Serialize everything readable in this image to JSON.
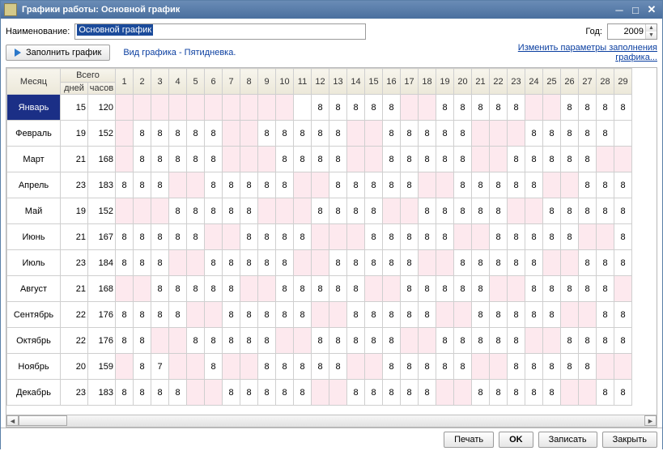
{
  "window": {
    "title": "Графики работы: Основной график"
  },
  "labels": {
    "name": "Наименование:",
    "year": "Год:",
    "fill_button": "Заполнить график",
    "schedule_info": "Вид графика - Пятидневка.",
    "change_link_line1": "Изменить параметры заполнения",
    "change_link_line2": "графика...",
    "header_month": "Месяц",
    "header_total": "Всего",
    "header_days": "дней",
    "header_hours": "часов"
  },
  "name_value": "Основной график",
  "year_value": "2009",
  "footer": {
    "print": "Печать",
    "ok": "OK",
    "save": "Записать",
    "close": "Закрыть"
  },
  "day_numbers": [
    1,
    2,
    3,
    4,
    5,
    6,
    7,
    8,
    9,
    10,
    11,
    12,
    13,
    14,
    15,
    16,
    17,
    18,
    19,
    20,
    21,
    22,
    23,
    24,
    25,
    26,
    27,
    28,
    29
  ],
  "months": [
    {
      "name": "Январь",
      "days": 15,
      "hours": 120,
      "selected": true,
      "cells": [
        "o",
        "o",
        "o",
        "o",
        "o",
        "o",
        "o",
        "o",
        "o",
        "o",
        "",
        "8",
        "8",
        "8",
        "8",
        "8",
        "o",
        "o",
        "8",
        "8",
        "8",
        "8",
        "8",
        "o",
        "o",
        "8",
        "8",
        "8",
        "8"
      ]
    },
    {
      "name": "Февраль",
      "days": 19,
      "hours": 152,
      "cells": [
        "o",
        "8",
        "8",
        "8",
        "8",
        "8",
        "o",
        "o",
        "8",
        "8",
        "8",
        "8",
        "8",
        "o",
        "o",
        "8",
        "8",
        "8",
        "8",
        "8",
        "o",
        "o",
        "o",
        "8",
        "8",
        "8",
        "8",
        "8",
        ""
      ]
    },
    {
      "name": "Март",
      "days": 21,
      "hours": 168,
      "cells": [
        "o",
        "8",
        "8",
        "8",
        "8",
        "8",
        "o",
        "o",
        "o",
        "8",
        "8",
        "8",
        "8",
        "o",
        "o",
        "8",
        "8",
        "8",
        "8",
        "8",
        "o",
        "o",
        "8",
        "8",
        "8",
        "8",
        "8",
        "o",
        "o"
      ]
    },
    {
      "name": "Апрель",
      "days": 23,
      "hours": 183,
      "cells": [
        "8",
        "8",
        "8",
        "o",
        "o",
        "8",
        "8",
        "8",
        "8",
        "8",
        "o",
        "o",
        "8",
        "8",
        "8",
        "8",
        "8",
        "o",
        "o",
        "8",
        "8",
        "8",
        "8",
        "8",
        "o",
        "o",
        "8",
        "8",
        "8"
      ]
    },
    {
      "name": "Май",
      "days": 19,
      "hours": 152,
      "cells": [
        "o",
        "o",
        "o",
        "8",
        "8",
        "8",
        "8",
        "8",
        "o",
        "o",
        "o",
        "8",
        "8",
        "8",
        "8",
        "o",
        "o",
        "8",
        "8",
        "8",
        "8",
        "8",
        "o",
        "o",
        "8",
        "8",
        "8",
        "8",
        "8"
      ]
    },
    {
      "name": "Июнь",
      "days": 21,
      "hours": 167,
      "cells": [
        "8",
        "8",
        "8",
        "8",
        "8",
        "o",
        "o",
        "8",
        "8",
        "8",
        "8",
        "o",
        "o",
        "o",
        "8",
        "8",
        "8",
        "8",
        "8",
        "o",
        "o",
        "8",
        "8",
        "8",
        "8",
        "8",
        "o",
        "o",
        "8"
      ]
    },
    {
      "name": "Июль",
      "days": 23,
      "hours": 184,
      "cells": [
        "8",
        "8",
        "8",
        "o",
        "o",
        "8",
        "8",
        "8",
        "8",
        "8",
        "o",
        "o",
        "8",
        "8",
        "8",
        "8",
        "8",
        "o",
        "o",
        "8",
        "8",
        "8",
        "8",
        "8",
        "o",
        "o",
        "8",
        "8",
        "8"
      ]
    },
    {
      "name": "Август",
      "days": 21,
      "hours": 168,
      "cells": [
        "o",
        "o",
        "8",
        "8",
        "8",
        "8",
        "8",
        "o",
        "o",
        "8",
        "8",
        "8",
        "8",
        "8",
        "o",
        "o",
        "8",
        "8",
        "8",
        "8",
        "8",
        "o",
        "o",
        "8",
        "8",
        "8",
        "8",
        "8",
        "o"
      ]
    },
    {
      "name": "Сентябрь",
      "days": 22,
      "hours": 176,
      "cells": [
        "8",
        "8",
        "8",
        "8",
        "o",
        "o",
        "8",
        "8",
        "8",
        "8",
        "8",
        "o",
        "o",
        "8",
        "8",
        "8",
        "8",
        "8",
        "o",
        "o",
        "8",
        "8",
        "8",
        "8",
        "8",
        "o",
        "o",
        "8",
        "8"
      ]
    },
    {
      "name": "Октябрь",
      "days": 22,
      "hours": 176,
      "cells": [
        "8",
        "8",
        "o",
        "o",
        "8",
        "8",
        "8",
        "8",
        "8",
        "o",
        "o",
        "8",
        "8",
        "8",
        "8",
        "8",
        "o",
        "o",
        "8",
        "8",
        "8",
        "8",
        "8",
        "o",
        "o",
        "8",
        "8",
        "8",
        "8"
      ]
    },
    {
      "name": "Ноябрь",
      "days": 20,
      "hours": 159,
      "cells": [
        "o",
        "8",
        "7",
        "o",
        "o",
        "8",
        "o",
        "o",
        "8",
        "8",
        "8",
        "8",
        "8",
        "o",
        "o",
        "8",
        "8",
        "8",
        "8",
        "8",
        "o",
        "o",
        "8",
        "8",
        "8",
        "8",
        "8",
        "o",
        "o"
      ]
    },
    {
      "name": "Декабрь",
      "days": 23,
      "hours": 183,
      "cells": [
        "8",
        "8",
        "8",
        "8",
        "o",
        "o",
        "8",
        "8",
        "8",
        "8",
        "8",
        "o",
        "o",
        "8",
        "8",
        "8",
        "8",
        "8",
        "o",
        "o",
        "8",
        "8",
        "8",
        "8",
        "8",
        "o",
        "o",
        "8",
        "8"
      ]
    }
  ]
}
